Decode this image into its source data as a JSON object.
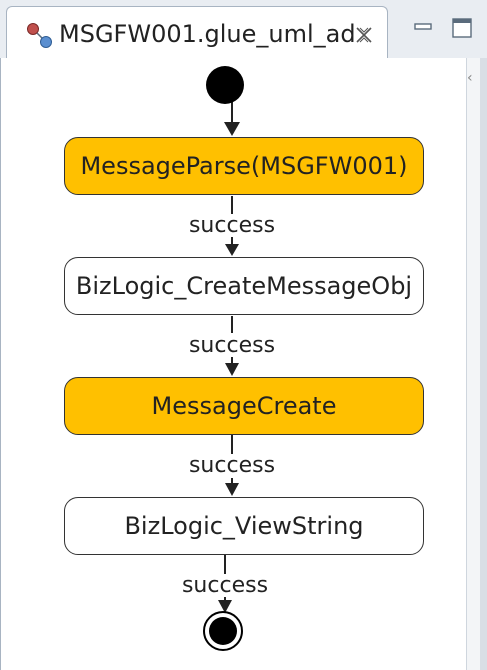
{
  "editor": {
    "tab_title": "MSGFW001.glue_uml_ad",
    "tab_icon": "activity-diagram-icon",
    "close_icon": "close-icon",
    "minimize_icon": "minimize-icon",
    "maximize_icon": "maximize-icon"
  },
  "diagram": {
    "nodes": [
      {
        "label": "MessageParse(MSGFW001)",
        "style": "highlight"
      },
      {
        "label": "BizLogic_CreateMessageObj",
        "style": "plain"
      },
      {
        "label": "MessageCreate",
        "style": "highlight"
      },
      {
        "label": "BizLogic_ViewString",
        "style": "plain"
      }
    ],
    "edges": [
      {
        "label": "success"
      },
      {
        "label": "success"
      },
      {
        "label": "success"
      },
      {
        "label": "success"
      }
    ]
  },
  "colors": {
    "highlight": "#ffc000",
    "plain": "#ffffff",
    "border": "#333333"
  }
}
